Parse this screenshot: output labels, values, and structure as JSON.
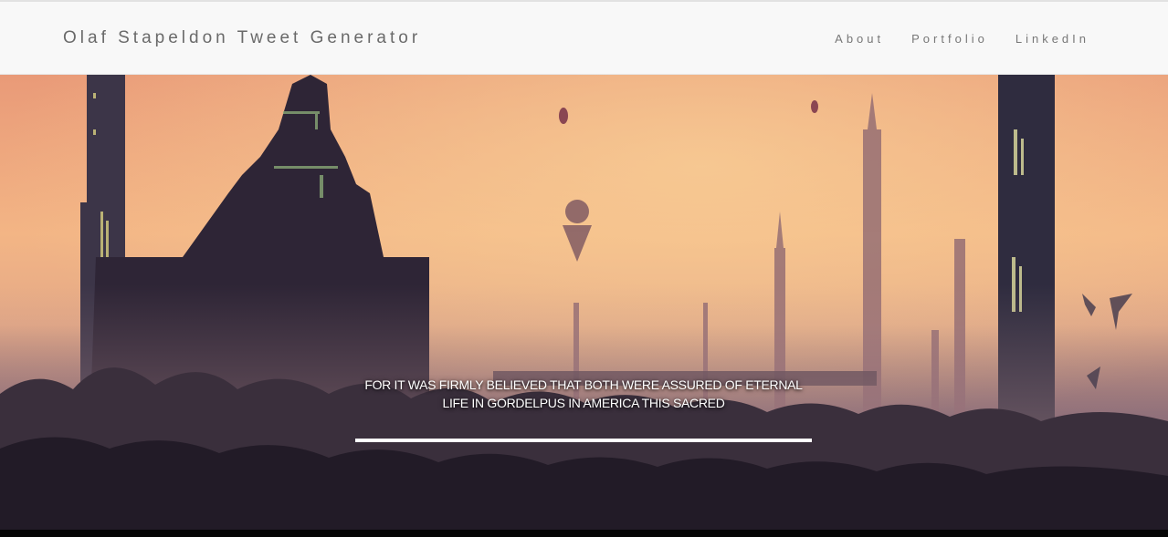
{
  "navbar": {
    "brand": "Olaf Stapeldon Tweet Generator",
    "links": [
      {
        "label": "About"
      },
      {
        "label": "Portfolio"
      },
      {
        "label": "LinkedIn"
      }
    ]
  },
  "hero": {
    "background": "sci-fi-city-sunset-illustration",
    "tweet_text": "FOR IT WAS FIRMLY BELIEVED THAT BOTH WERE ASSURED OF ETERNAL LIFE IN GORDELPUS IN AMERICA THIS SACRED"
  },
  "colors": {
    "sky_top": "#e9a07a",
    "sky_glow": "#f4c48c",
    "silhouette": "#3a2a3c",
    "navbar_bg": "#f8f8f8"
  }
}
